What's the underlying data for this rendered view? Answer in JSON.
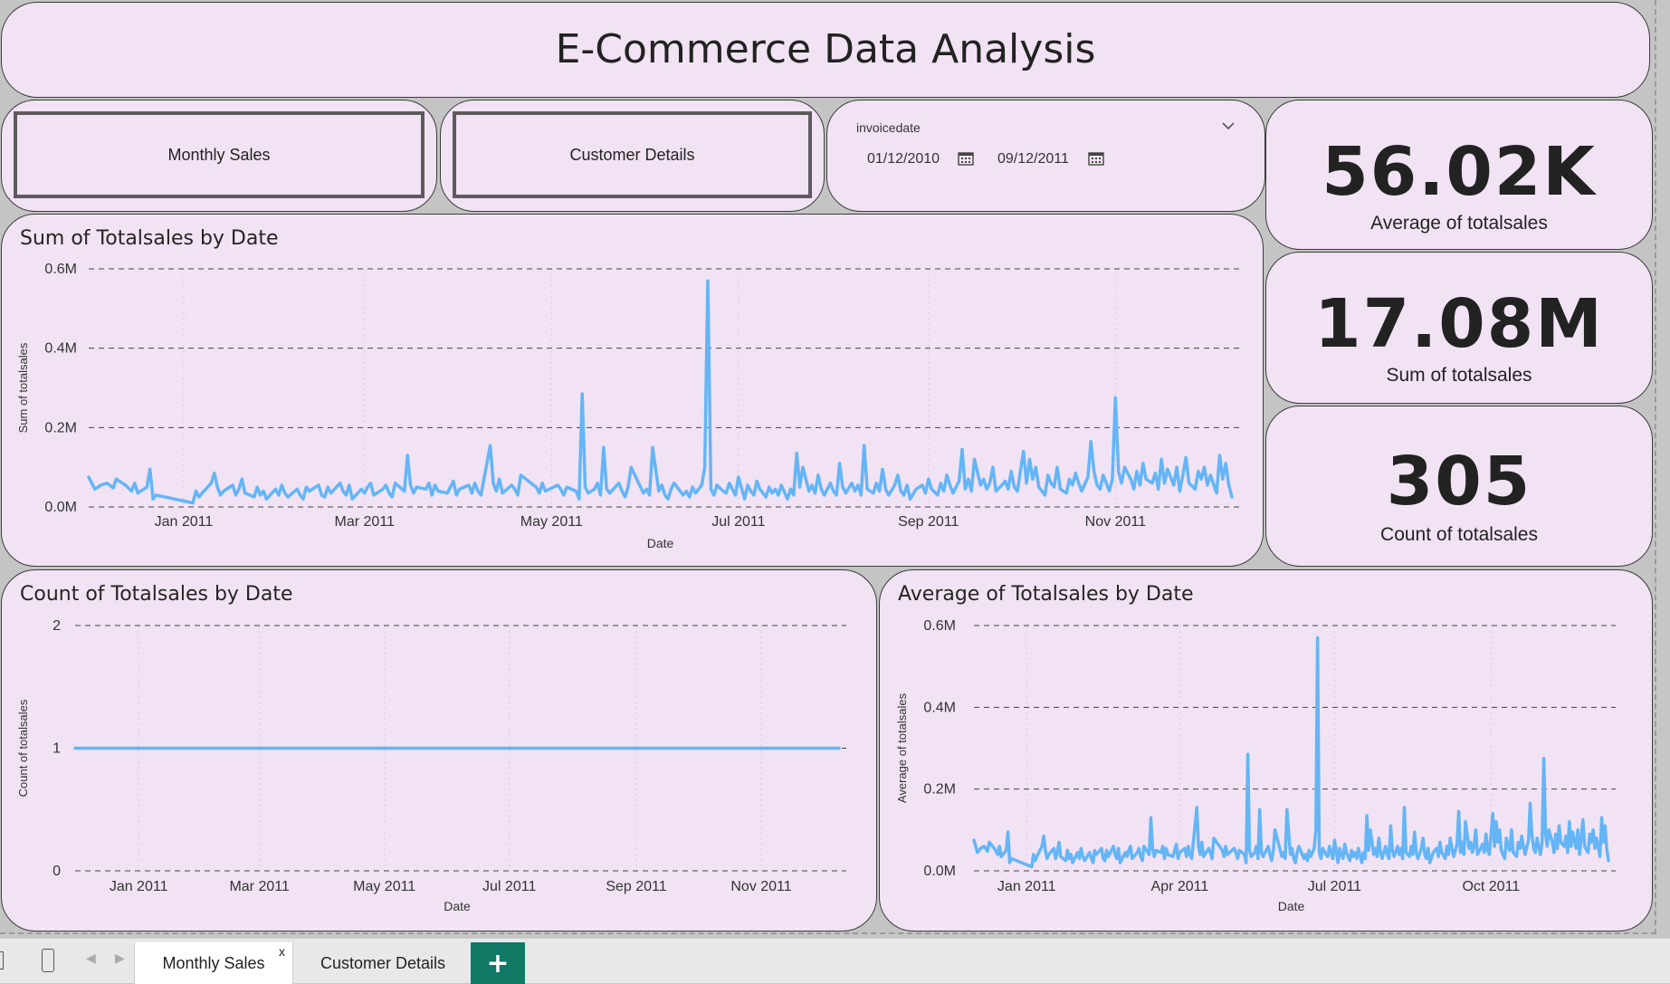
{
  "title": "E-Commerce Data Analysis",
  "nav": {
    "monthly_sales": "Monthly Sales",
    "customer_details": "Customer Details"
  },
  "slicer": {
    "label": "invoicedate",
    "start": "01/12/2010",
    "end": "09/12/2011"
  },
  "kpis": [
    {
      "value": "56.02K",
      "label": "Average of totalsales"
    },
    {
      "value": "17.08M",
      "label": "Sum of totalsales"
    },
    {
      "value": "305",
      "label": "Count of totalsales"
    }
  ],
  "tabs": {
    "monthly_sales": "Monthly Sales",
    "close": "x",
    "customer_details": "Customer Details",
    "add": "+"
  },
  "colors": {
    "line": "#64b5f6",
    "card_bg": "#f1e3f3",
    "add_tab": "#117865"
  },
  "chart_data": [
    {
      "id": "sum",
      "type": "line",
      "title": "Sum of Totalsales by Date",
      "xlabel": "Date",
      "ylabel": "Sum of totalsales",
      "x_range": [
        "2010-12-01",
        "2011-12-09"
      ],
      "x_ticks": [
        {
          "date": "2011-01-01",
          "label": "Jan 2011"
        },
        {
          "date": "2011-03-01",
          "label": "Mar 2011"
        },
        {
          "date": "2011-05-01",
          "label": "May 2011"
        },
        {
          "date": "2011-07-01",
          "label": "Jul 2011"
        },
        {
          "date": "2011-09-01",
          "label": "Sep 2011"
        },
        {
          "date": "2011-11-01",
          "label": "Nov 2011"
        }
      ],
      "y_ticks": [
        {
          "value": 0,
          "label": "0.0M"
        },
        {
          "value": 200000,
          "label": "0.2M"
        },
        {
          "value": 400000,
          "label": "0.4M"
        },
        {
          "value": 600000,
          "label": "0.6M"
        }
      ],
      "ylim": [
        0,
        600000
      ],
      "grid": true
    },
    {
      "id": "count",
      "type": "line",
      "title": "Count of Totalsales by Date",
      "xlabel": "Date",
      "ylabel": "Count of totalsales",
      "x_range": [
        "2010-12-01",
        "2011-12-09"
      ],
      "x_ticks": [
        {
          "date": "2011-01-01",
          "label": "Jan 2011"
        },
        {
          "date": "2011-03-01",
          "label": "Mar 2011"
        },
        {
          "date": "2011-05-01",
          "label": "May 2011"
        },
        {
          "date": "2011-07-01",
          "label": "Jul 2011"
        },
        {
          "date": "2011-09-01",
          "label": "Sep 2011"
        },
        {
          "date": "2011-11-01",
          "label": "Nov 2011"
        }
      ],
      "y_ticks": [
        {
          "value": 0,
          "label": "0"
        },
        {
          "value": 1,
          "label": "1"
        },
        {
          "value": 2,
          "label": "2"
        }
      ],
      "ylim": [
        0,
        2
      ],
      "grid": true
    },
    {
      "id": "avg",
      "type": "line",
      "title": "Average of Totalsales by Date",
      "xlabel": "Date",
      "ylabel": "Average of totalsales",
      "x_range": [
        "2010-12-01",
        "2011-12-09"
      ],
      "x_ticks": [
        {
          "date": "2011-01-01",
          "label": "Jan 2011"
        },
        {
          "date": "2011-04-01",
          "label": "Apr 2011"
        },
        {
          "date": "2011-07-01",
          "label": "Jul 2011"
        },
        {
          "date": "2011-10-01",
          "label": "Oct 2011"
        }
      ],
      "y_ticks": [
        {
          "value": 0,
          "label": "0.0M"
        },
        {
          "value": 200000,
          "label": "0.2M"
        },
        {
          "value": 400000,
          "label": "0.4M"
        },
        {
          "value": 600000,
          "label": "0.6M"
        }
      ],
      "ylim": [
        0,
        600000
      ],
      "grid": true
    }
  ],
  "series_points": [
    [
      "2010-12-01",
      75000
    ],
    [
      "2010-12-03",
      45000
    ],
    [
      "2010-12-05",
      55000
    ],
    [
      "2010-12-07",
      60000
    ],
    [
      "2010-12-09",
      48000
    ],
    [
      "2010-12-10",
      70000
    ],
    [
      "2010-12-13",
      55000
    ],
    [
      "2010-12-15",
      40000
    ],
    [
      "2010-12-16",
      60000
    ],
    [
      "2010-12-17",
      35000
    ],
    [
      "2010-12-20",
      50000
    ],
    [
      "2010-12-21",
      95000
    ],
    [
      "2010-12-22",
      20000
    ],
    [
      "2010-12-23",
      30000
    ],
    [
      "2011-01-04",
      10000
    ],
    [
      "2011-01-05",
      40000
    ],
    [
      "2011-01-06",
      25000
    ],
    [
      "2011-01-07",
      35000
    ],
    [
      "2011-01-10",
      60000
    ],
    [
      "2011-01-11",
      85000
    ],
    [
      "2011-01-12",
      50000
    ],
    [
      "2011-01-13",
      30000
    ],
    [
      "2011-01-14",
      40000
    ],
    [
      "2011-01-17",
      55000
    ],
    [
      "2011-01-18",
      30000
    ],
    [
      "2011-01-19",
      45000
    ],
    [
      "2011-01-20",
      70000
    ],
    [
      "2011-01-21",
      35000
    ],
    [
      "2011-01-24",
      25000
    ],
    [
      "2011-01-25",
      50000
    ],
    [
      "2011-01-26",
      30000
    ],
    [
      "2011-01-27",
      40000
    ],
    [
      "2011-01-28",
      20000
    ],
    [
      "2011-01-31",
      45000
    ],
    [
      "2011-02-01",
      30000
    ],
    [
      "2011-02-02",
      55000
    ],
    [
      "2011-02-03",
      35000
    ],
    [
      "2011-02-04",
      25000
    ],
    [
      "2011-02-07",
      45000
    ],
    [
      "2011-02-08",
      30000
    ],
    [
      "2011-02-09",
      20000
    ],
    [
      "2011-02-10",
      50000
    ],
    [
      "2011-02-11",
      40000
    ],
    [
      "2011-02-14",
      55000
    ],
    [
      "2011-02-15",
      30000
    ],
    [
      "2011-02-16",
      25000
    ],
    [
      "2011-02-17",
      50000
    ],
    [
      "2011-02-18",
      35000
    ],
    [
      "2011-02-21",
      60000
    ],
    [
      "2011-02-22",
      40000
    ],
    [
      "2011-02-23",
      30000
    ],
    [
      "2011-02-24",
      55000
    ],
    [
      "2011-02-25",
      20000
    ],
    [
      "2011-02-28",
      45000
    ],
    [
      "2011-03-01",
      35000
    ],
    [
      "2011-03-02",
      50000
    ],
    [
      "2011-03-03",
      60000
    ],
    [
      "2011-03-04",
      30000
    ],
    [
      "2011-03-07",
      45000
    ],
    [
      "2011-03-08",
      55000
    ],
    [
      "2011-03-09",
      35000
    ],
    [
      "2011-03-10",
      25000
    ],
    [
      "2011-03-11",
      60000
    ],
    [
      "2011-03-14",
      40000
    ],
    [
      "2011-03-15",
      130000
    ],
    [
      "2011-03-16",
      55000
    ],
    [
      "2011-03-17",
      35000
    ],
    [
      "2011-03-18",
      50000
    ],
    [
      "2011-03-21",
      45000
    ],
    [
      "2011-03-22",
      60000
    ],
    [
      "2011-03-23",
      30000
    ],
    [
      "2011-03-24",
      55000
    ],
    [
      "2011-03-25",
      40000
    ],
    [
      "2011-03-28",
      35000
    ],
    [
      "2011-03-29",
      50000
    ],
    [
      "2011-03-30",
      65000
    ],
    [
      "2011-03-31",
      30000
    ],
    [
      "2011-04-01",
      45000
    ],
    [
      "2011-04-04",
      55000
    ],
    [
      "2011-04-05",
      35000
    ],
    [
      "2011-04-06",
      60000
    ],
    [
      "2011-04-07",
      40000
    ],
    [
      "2011-04-08",
      30000
    ],
    [
      "2011-04-11",
      155000
    ],
    [
      "2011-04-12",
      60000
    ],
    [
      "2011-04-13",
      40000
    ],
    [
      "2011-04-14",
      70000
    ],
    [
      "2011-04-15",
      35000
    ],
    [
      "2011-04-18",
      55000
    ],
    [
      "2011-04-19",
      45000
    ],
    [
      "2011-04-20",
      30000
    ],
    [
      "2011-04-21",
      80000
    ],
    [
      "2011-04-26",
      50000
    ],
    [
      "2011-04-27",
      35000
    ],
    [
      "2011-04-28",
      60000
    ],
    [
      "2011-04-29",
      40000
    ],
    [
      "2011-05-03",
      55000
    ],
    [
      "2011-05-04",
      45000
    ],
    [
      "2011-05-05",
      30000
    ],
    [
      "2011-05-06",
      50000
    ],
    [
      "2011-05-09",
      40000
    ],
    [
      "2011-05-10",
      20000
    ],
    [
      "2011-05-11",
      285000
    ],
    [
      "2011-05-12",
      50000
    ],
    [
      "2011-05-13",
      35000
    ],
    [
      "2011-05-15",
      45000
    ],
    [
      "2011-05-16",
      60000
    ],
    [
      "2011-05-17",
      30000
    ],
    [
      "2011-05-18",
      150000
    ],
    [
      "2011-05-19",
      45000
    ],
    [
      "2011-05-20",
      35000
    ],
    [
      "2011-05-23",
      60000
    ],
    [
      "2011-05-24",
      40000
    ],
    [
      "2011-05-25",
      25000
    ],
    [
      "2011-05-26",
      50000
    ],
    [
      "2011-05-27",
      100000
    ],
    [
      "2011-05-31",
      35000
    ],
    [
      "2011-06-01",
      45000
    ],
    [
      "2011-06-02",
      30000
    ],
    [
      "2011-06-03",
      150000
    ],
    [
      "2011-06-05",
      40000
    ],
    [
      "2011-06-06",
      55000
    ],
    [
      "2011-06-07",
      30000
    ],
    [
      "2011-06-08",
      20000
    ],
    [
      "2011-06-09",
      45000
    ],
    [
      "2011-06-10",
      60000
    ],
    [
      "2011-06-13",
      30000
    ],
    [
      "2011-06-14",
      40000
    ],
    [
      "2011-06-15",
      25000
    ],
    [
      "2011-06-16",
      50000
    ],
    [
      "2011-06-17",
      35000
    ],
    [
      "2011-06-19",
      55000
    ],
    [
      "2011-06-20",
      100000
    ],
    [
      "2011-06-21",
      570000
    ],
    [
      "2011-06-22",
      45000
    ],
    [
      "2011-06-23",
      30000
    ],
    [
      "2011-06-24",
      55000
    ],
    [
      "2011-06-26",
      40000
    ],
    [
      "2011-06-27",
      35000
    ],
    [
      "2011-06-28",
      60000
    ],
    [
      "2011-06-29",
      45000
    ],
    [
      "2011-06-30",
      30000
    ],
    [
      "2011-07-01",
      75000
    ],
    [
      "2011-07-03",
      20000
    ],
    [
      "2011-07-04",
      55000
    ],
    [
      "2011-07-05",
      40000
    ],
    [
      "2011-07-06",
      30000
    ],
    [
      "2011-07-07",
      65000
    ],
    [
      "2011-07-08",
      45000
    ],
    [
      "2011-07-10",
      25000
    ],
    [
      "2011-07-11",
      50000
    ],
    [
      "2011-07-12",
      35000
    ],
    [
      "2011-07-13",
      45000
    ],
    [
      "2011-07-14",
      30000
    ],
    [
      "2011-07-15",
      55000
    ],
    [
      "2011-07-17",
      20000
    ],
    [
      "2011-07-18",
      45000
    ],
    [
      "2011-07-19",
      30000
    ],
    [
      "2011-07-20",
      135000
    ],
    [
      "2011-07-21",
      50000
    ],
    [
      "2011-07-22",
      100000
    ],
    [
      "2011-07-24",
      40000
    ],
    [
      "2011-07-25",
      55000
    ],
    [
      "2011-07-26",
      35000
    ],
    [
      "2011-07-27",
      80000
    ],
    [
      "2011-07-28",
      45000
    ],
    [
      "2011-07-29",
      30000
    ],
    [
      "2011-07-31",
      60000
    ],
    [
      "2011-08-01",
      40000
    ],
    [
      "2011-08-02",
      30000
    ],
    [
      "2011-08-03",
      110000
    ],
    [
      "2011-08-04",
      50000
    ],
    [
      "2011-08-05",
      35000
    ],
    [
      "2011-08-07",
      60000
    ],
    [
      "2011-08-08",
      40000
    ],
    [
      "2011-08-09",
      55000
    ],
    [
      "2011-08-10",
      30000
    ],
    [
      "2011-08-11",
      155000
    ],
    [
      "2011-08-12",
      45000
    ],
    [
      "2011-08-14",
      35000
    ],
    [
      "2011-08-15",
      60000
    ],
    [
      "2011-08-16",
      40000
    ],
    [
      "2011-08-17",
      95000
    ],
    [
      "2011-08-18",
      45000
    ],
    [
      "2011-08-19",
      30000
    ],
    [
      "2011-08-21",
      55000
    ],
    [
      "2011-08-22",
      80000
    ],
    [
      "2011-08-23",
      40000
    ],
    [
      "2011-08-24",
      30000
    ],
    [
      "2011-08-25",
      55000
    ],
    [
      "2011-08-26",
      20000
    ],
    [
      "2011-08-28",
      45000
    ],
    [
      "2011-08-30",
      55000
    ],
    [
      "2011-08-31",
      35000
    ],
    [
      "2011-09-01",
      70000
    ],
    [
      "2011-09-02",
      45000
    ],
    [
      "2011-09-04",
      30000
    ],
    [
      "2011-09-05",
      60000
    ],
    [
      "2011-09-06",
      40000
    ],
    [
      "2011-09-07",
      80000
    ],
    [
      "2011-09-08",
      55000
    ],
    [
      "2011-09-09",
      35000
    ],
    [
      "2011-09-11",
      65000
    ],
    [
      "2011-09-12",
      145000
    ],
    [
      "2011-09-13",
      45000
    ],
    [
      "2011-09-14",
      70000
    ],
    [
      "2011-09-15",
      40000
    ],
    [
      "2011-09-16",
      120000
    ],
    [
      "2011-09-18",
      55000
    ],
    [
      "2011-09-19",
      70000
    ],
    [
      "2011-09-20",
      45000
    ],
    [
      "2011-09-21",
      60000
    ],
    [
      "2011-09-22",
      100000
    ],
    [
      "2011-09-23",
      40000
    ],
    [
      "2011-09-25",
      55000
    ],
    [
      "2011-09-26",
      65000
    ],
    [
      "2011-09-27",
      45000
    ],
    [
      "2011-09-28",
      90000
    ],
    [
      "2011-09-29",
      50000
    ],
    [
      "2011-09-30",
      40000
    ],
    [
      "2011-10-02",
      140000
    ],
    [
      "2011-10-03",
      60000
    ],
    [
      "2011-10-04",
      120000
    ],
    [
      "2011-10-05",
      70000
    ],
    [
      "2011-10-06",
      100000
    ],
    [
      "2011-10-07",
      50000
    ],
    [
      "2011-10-09",
      30000
    ],
    [
      "2011-10-10",
      80000
    ],
    [
      "2011-10-11",
      60000
    ],
    [
      "2011-10-12",
      50000
    ],
    [
      "2011-10-13",
      100000
    ],
    [
      "2011-10-14",
      45000
    ],
    [
      "2011-10-16",
      35000
    ],
    [
      "2011-10-17",
      70000
    ],
    [
      "2011-10-18",
      55000
    ],
    [
      "2011-10-19",
      85000
    ],
    [
      "2011-10-20",
      60000
    ],
    [
      "2011-10-21",
      40000
    ],
    [
      "2011-10-23",
      75000
    ],
    [
      "2011-10-24",
      165000
    ],
    [
      "2011-10-25",
      90000
    ],
    [
      "2011-10-26",
      55000
    ],
    [
      "2011-10-27",
      45000
    ],
    [
      "2011-10-28",
      80000
    ],
    [
      "2011-10-30",
      40000
    ],
    [
      "2011-10-31",
      70000
    ],
    [
      "2011-11-01",
      275000
    ],
    [
      "2011-11-02",
      90000
    ],
    [
      "2011-11-03",
      60000
    ],
    [
      "2011-11-04",
      100000
    ],
    [
      "2011-11-06",
      70000
    ],
    [
      "2011-11-07",
      45000
    ],
    [
      "2011-11-08",
      90000
    ],
    [
      "2011-11-09",
      55000
    ],
    [
      "2011-11-10",
      110000
    ],
    [
      "2011-11-11",
      70000
    ],
    [
      "2011-11-13",
      60000
    ],
    [
      "2011-11-14",
      85000
    ],
    [
      "2011-11-15",
      45000
    ],
    [
      "2011-11-16",
      120000
    ],
    [
      "2011-11-17",
      60000
    ],
    [
      "2011-11-18",
      95000
    ],
    [
      "2011-11-20",
      55000
    ],
    [
      "2011-11-21",
      100000
    ],
    [
      "2011-11-22",
      40000
    ],
    [
      "2011-11-23",
      80000
    ],
    [
      "2011-11-24",
      125000
    ],
    [
      "2011-11-25",
      60000
    ],
    [
      "2011-11-27",
      45000
    ],
    [
      "2011-11-28",
      90000
    ],
    [
      "2011-11-29",
      70000
    ],
    [
      "2011-11-30",
      100000
    ],
    [
      "2011-12-01",
      55000
    ],
    [
      "2011-12-02",
      80000
    ],
    [
      "2011-12-04",
      35000
    ],
    [
      "2011-12-05",
      130000
    ],
    [
      "2011-12-06",
      70000
    ],
    [
      "2011-12-07",
      110000
    ],
    [
      "2011-12-08",
      55000
    ],
    [
      "2011-12-09",
      25000
    ]
  ]
}
